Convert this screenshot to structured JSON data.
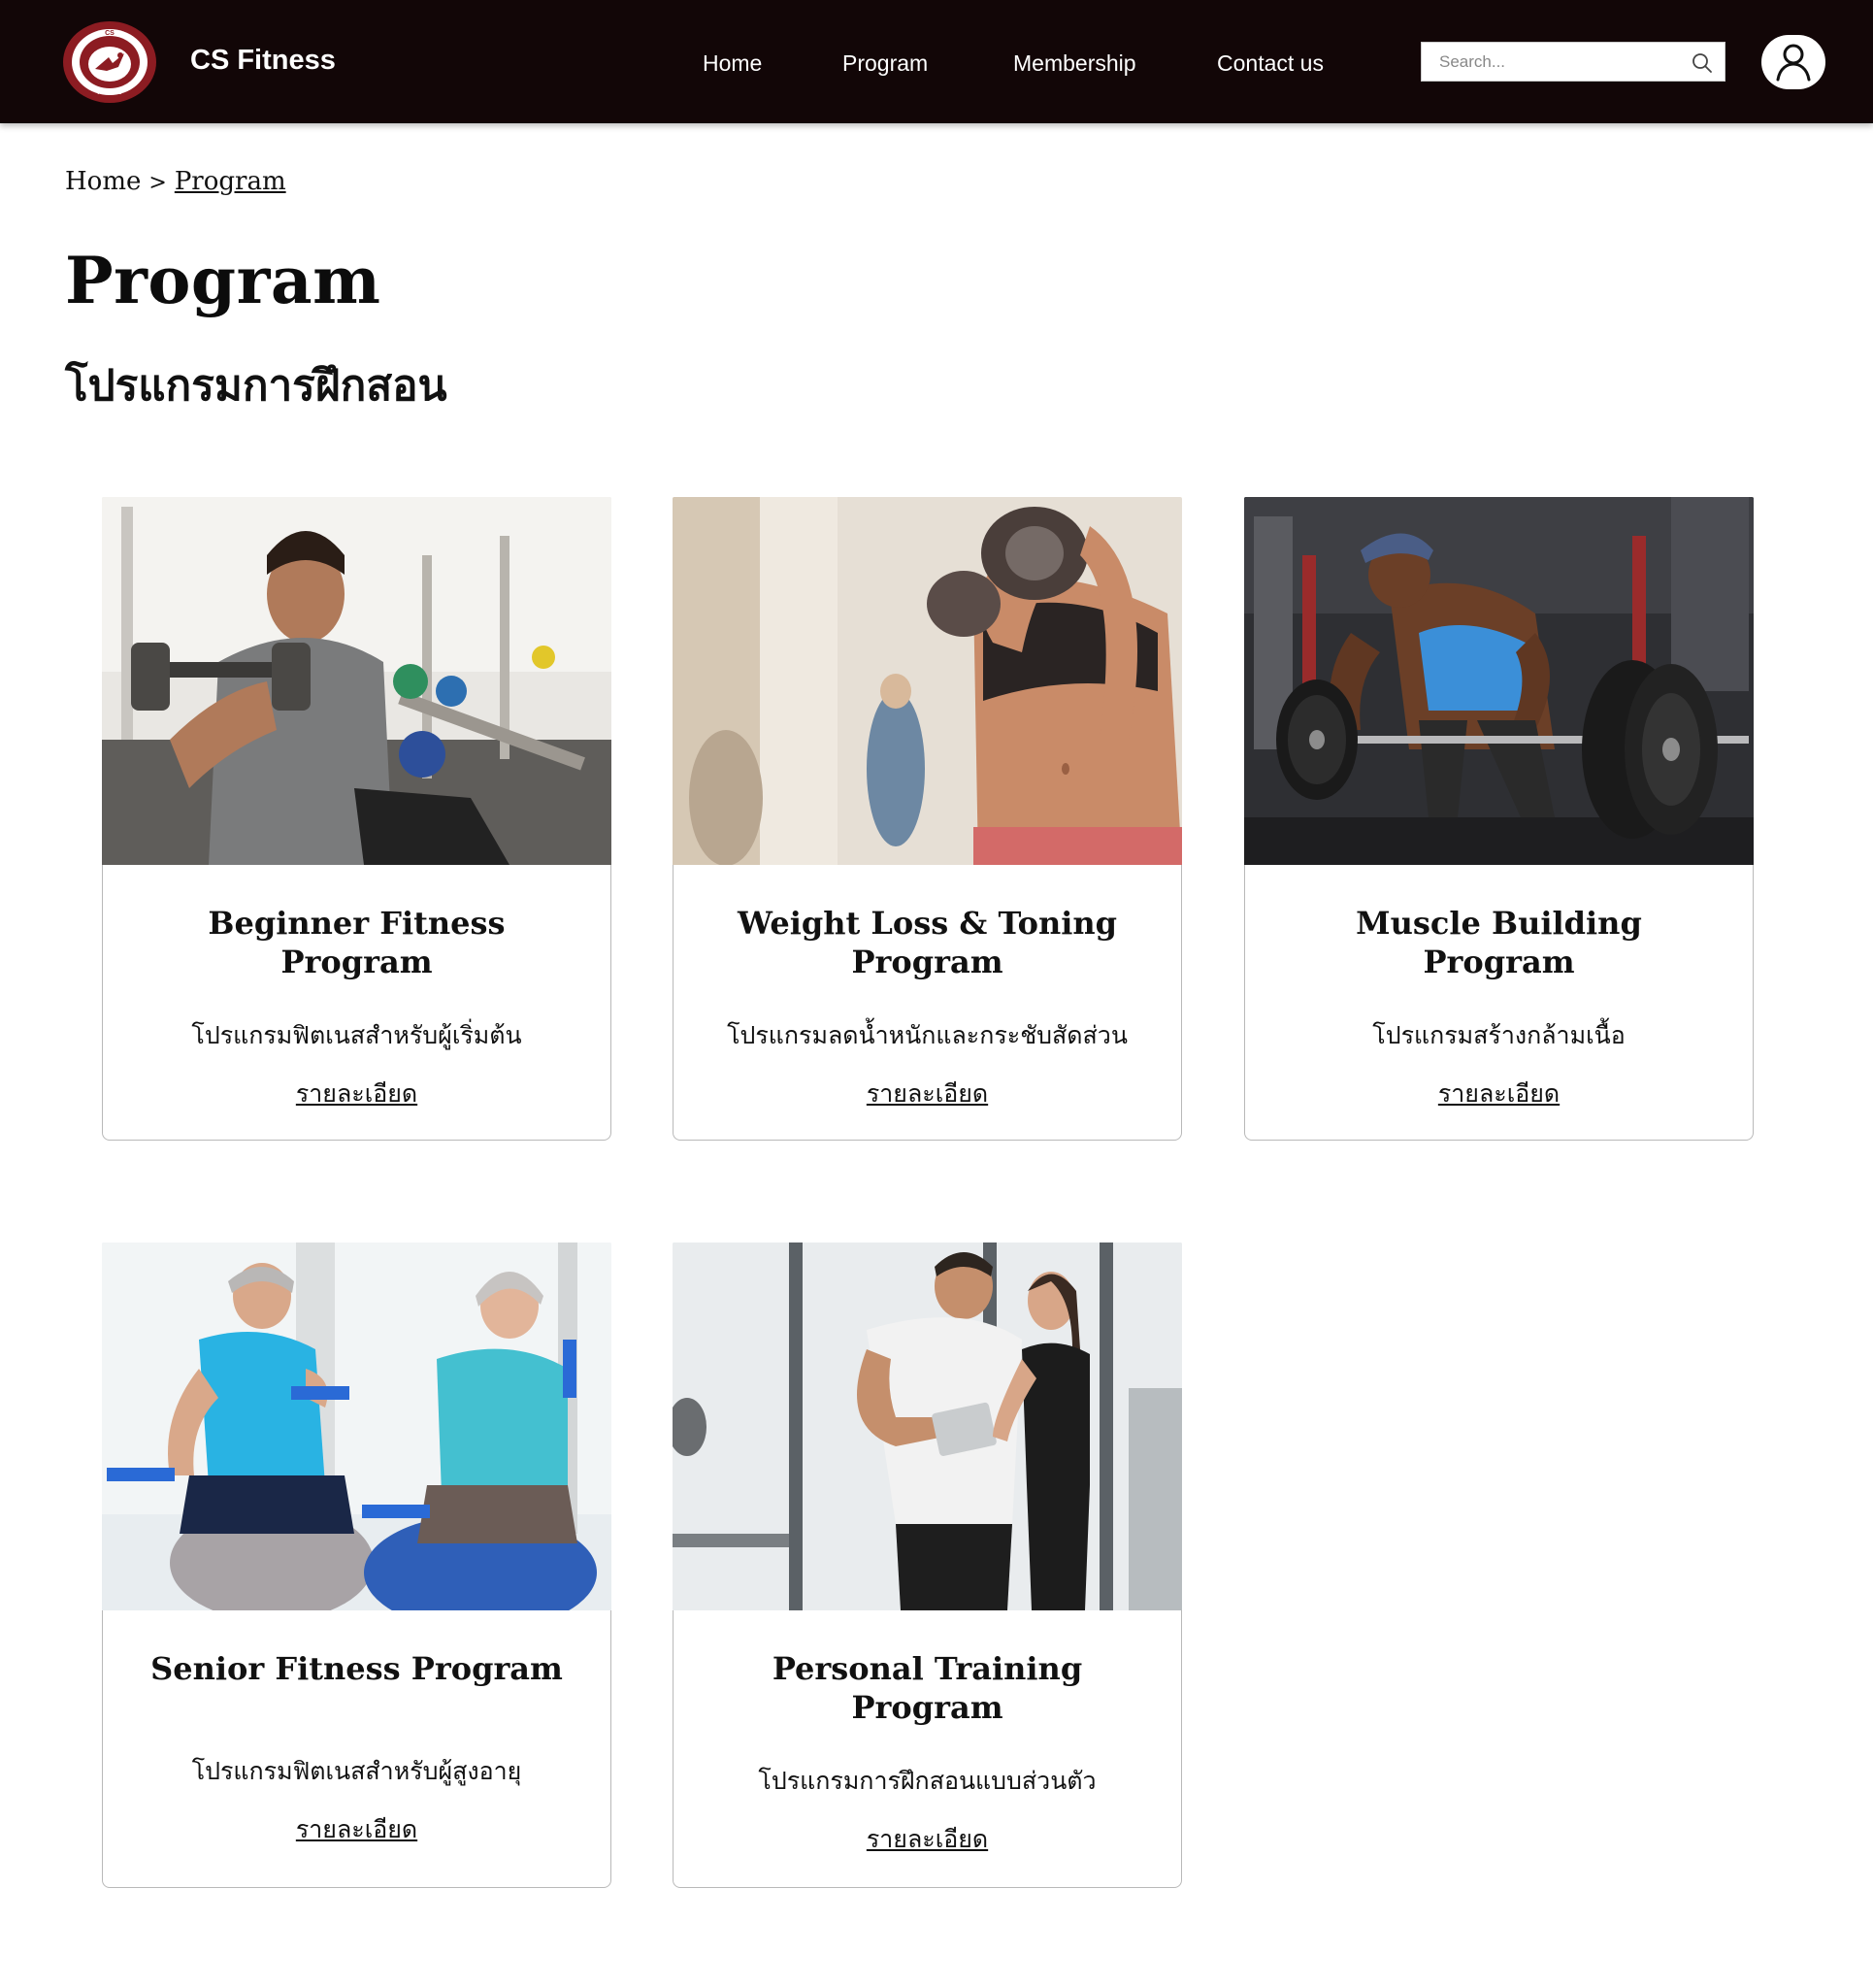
{
  "header": {
    "brand": "CS Fitness",
    "logo_text_top": "CS",
    "logo_text_bottom": "FITNESS",
    "nav": [
      {
        "label": "Home"
      },
      {
        "label": "Program"
      },
      {
        "label": "Membership"
      },
      {
        "label": "Contact us"
      }
    ],
    "search": {
      "placeholder": "Search...",
      "value": ""
    },
    "icons": {
      "search": "search-icon",
      "user": "user-icon"
    },
    "colors": {
      "bar": "#120607",
      "logo": "#8c1c22"
    }
  },
  "breadcrumb": {
    "home": "Home",
    "separator": ">",
    "current": "Program"
  },
  "page": {
    "title": "Program",
    "subtitle": "โปรแกรมการฝึกสอน"
  },
  "cards": [
    {
      "title": "Beginner Fitness Program",
      "description": "โปรแกรมฟิตเนสสำหรับผู้เริ่มต้น",
      "link": "รายละเอียด"
    },
    {
      "title": "Weight Loss & Toning Program",
      "description": "โปรแกรมลดน้ำหนักและกระชับสัดส่วน",
      "link": "รายละเอียด"
    },
    {
      "title": "Muscle Building Program",
      "description": "โปรแกรมสร้างกล้ามเนื้อ",
      "link": "รายละเอียด"
    },
    {
      "title": "Senior Fitness Program",
      "description": "โปรแกรมฟิตเนสสำหรับผู้สูงอายุ",
      "link": "รายละเอียด"
    },
    {
      "title": "Personal Training Program",
      "description": "โปรแกรมการฝึกสอนแบบส่วนตัว",
      "link": "รายละเอียด"
    }
  ]
}
